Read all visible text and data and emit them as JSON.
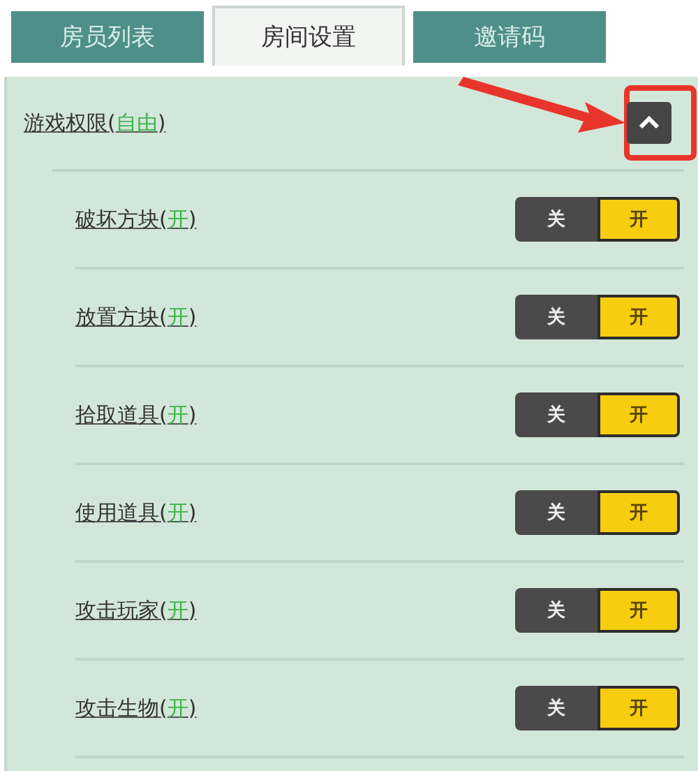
{
  "tabs": [
    {
      "label": "房员列表",
      "selected": false
    },
    {
      "label": "房间设置",
      "selected": true
    },
    {
      "label": "邀请码",
      "selected": false
    }
  ],
  "section": {
    "title": "游戏权限",
    "open": "(",
    "value": "自由",
    "close": ")",
    "expanded": true
  },
  "permissions": [
    {
      "name": "破坏方块",
      "open": "(",
      "value": "开",
      "close": ")",
      "off_label": "关",
      "on_label": "开",
      "on": true
    },
    {
      "name": "放置方块",
      "open": "(",
      "value": "开",
      "close": ")",
      "off_label": "关",
      "on_label": "开",
      "on": true
    },
    {
      "name": "拾取道具",
      "open": "(",
      "value": "开",
      "close": ")",
      "off_label": "关",
      "on_label": "开",
      "on": true
    },
    {
      "name": "使用道具",
      "open": "(",
      "value": "开",
      "close": ")",
      "off_label": "关",
      "on_label": "开",
      "on": true
    },
    {
      "name": "攻击玩家",
      "open": "(",
      "value": "开",
      "close": ")",
      "off_label": "关",
      "on_label": "开",
      "on": true
    },
    {
      "name": "攻击生物",
      "open": "(",
      "value": "开",
      "close": ")",
      "off_label": "关",
      "on_label": "开",
      "on": true
    }
  ]
}
